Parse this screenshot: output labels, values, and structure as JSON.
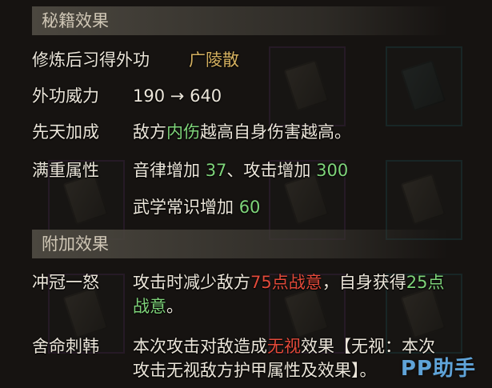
{
  "sections": {
    "effects_title": "秘籍效果",
    "extra_title": "附加效果"
  },
  "rows": {
    "learn": {
      "label": "修炼后习得外功",
      "skill": "广陵散"
    },
    "power": {
      "label": "外功威力",
      "from": "190",
      "arrow": "→",
      "to": "640"
    },
    "innate": {
      "label": "先天加成",
      "pre": "敌方",
      "hl": "内伤",
      "post": "越高自身伤害越高。"
    },
    "max_attr": {
      "label": "满重属性",
      "a_text": "音律增加 ",
      "a_val": "37",
      "sep": "、攻击增加 ",
      "b_val": "300",
      "c_text": "武学常识增加 ",
      "c_val": "60"
    },
    "rage": {
      "label": "冲冠一怒",
      "pre": "攻击时减少敌方",
      "val1": "75点战意",
      "mid": "，自身获得",
      "val2": "25点",
      "line2": "战意",
      "end": "。"
    },
    "sacrifice": {
      "label": "舍命刺韩",
      "pre": "本次攻击对敌造成",
      "hl": "无视",
      "post": "效果【无视：本次",
      "line2": "攻击无视敌方护甲属性及效果】。"
    }
  },
  "watermark": "PP助手",
  "colors": {
    "green": "#7fd47a",
    "red": "#e24a3a",
    "gold": "#d4b060",
    "watermark": "#5fa3d8"
  }
}
